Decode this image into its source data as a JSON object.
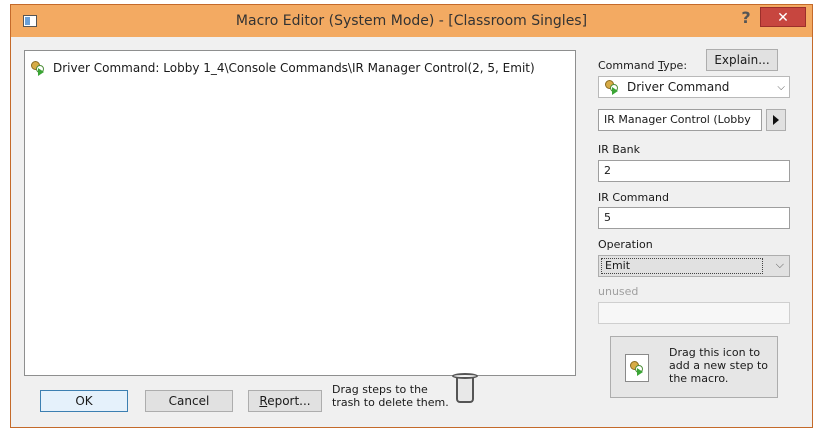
{
  "window": {
    "title": "Macro Editor (System Mode) - [Classroom Singles]",
    "help_glyph": "?",
    "close_glyph": "✕"
  },
  "steps": [
    {
      "text": "Driver Command: Lobby 1_4\\Console Commands\\IR Manager Control(2, 5, Emit)",
      "icon": "driver-command-icon"
    }
  ],
  "buttons": {
    "ok": "OK",
    "cancel": "Cancel",
    "report_u": "R",
    "report_rest": "eport..."
  },
  "trash_hint": "Drag steps to the trash to delete them.",
  "command_type": {
    "label_pre": "Command ",
    "label_u": "T",
    "label_post": "ype:",
    "explain": "Explain...",
    "value": "Driver Command"
  },
  "control": {
    "value": "IR Manager Control (Lobby"
  },
  "ir_bank": {
    "label": "IR Bank",
    "value": "2"
  },
  "ir_command": {
    "label": "IR Command",
    "value": "5"
  },
  "operation": {
    "label": "Operation",
    "value": "Emit"
  },
  "unused": {
    "label": "unused",
    "value": ""
  },
  "drag_panel": {
    "text": "Drag this icon to add a new step to the macro."
  },
  "colors": {
    "titlebar": "#f3aa62",
    "close": "#c7463f",
    "accent": "#3c7fb1"
  }
}
